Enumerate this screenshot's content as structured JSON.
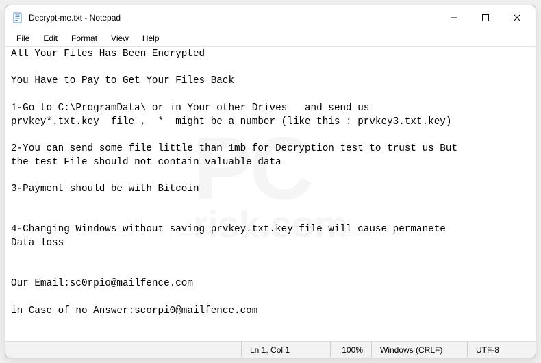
{
  "titlebar": {
    "title": "Decrypt-me.txt - Notepad"
  },
  "menu": {
    "file": "File",
    "edit": "Edit",
    "format": "Format",
    "view": "View",
    "help": "Help"
  },
  "body_text": "All Your Files Has Been Encrypted\n\nYou Have to Pay to Get Your Files Back\n\n1-Go to C:\\ProgramData\\ or in Your other Drives   and send us\nprvkey*.txt.key  file ,  *  might be a number (like this : prvkey3.txt.key)\n\n2-You can send some file little than 1mb for Decryption test to trust us But\nthe test File should not contain valuable data\n\n3-Payment should be with Bitcoin\n\n\n4-Changing Windows without saving prvkey.txt.key file will cause permanete\nData loss\n\n\nOur Email:sc0rpio@mailfence.com\n\nin Case of no Answer:scorpi0@mailfence.com",
  "status": {
    "cursor": "Ln 1, Col 1",
    "zoom": "100%",
    "line_ending": "Windows (CRLF)",
    "encoding": "UTF-8"
  }
}
